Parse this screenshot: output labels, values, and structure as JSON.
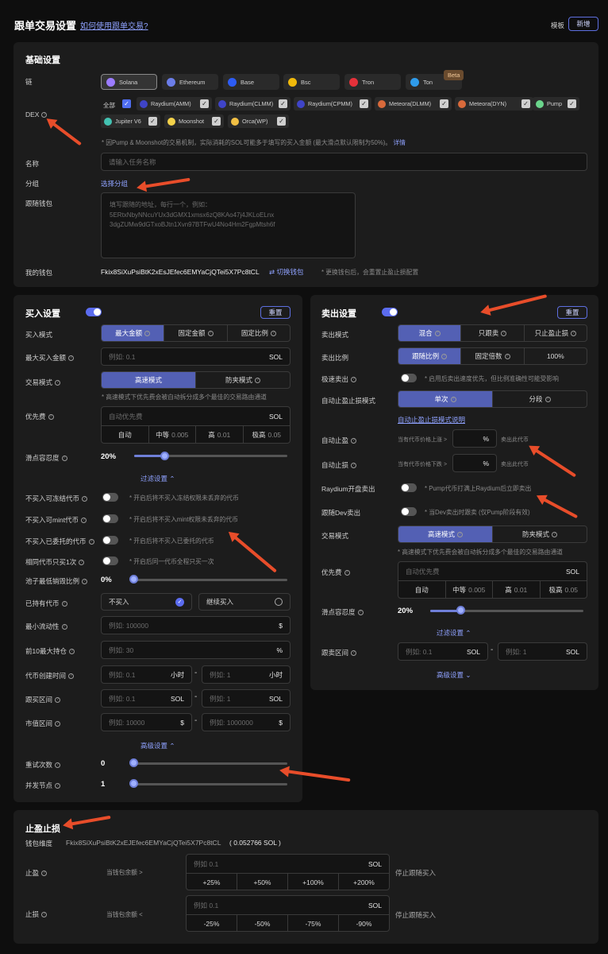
{
  "page": {
    "title": "跟单交易设置",
    "help_link": "如何使用跟单交易?",
    "template_label": "模板",
    "new_button": "新增"
  },
  "basic": {
    "title": "基础设置",
    "chain_label": "链",
    "chains": [
      {
        "name": "Solana",
        "color": "#9b7cff"
      },
      {
        "name": "Ethereum",
        "color": "#6b7de8"
      },
      {
        "name": "Base",
        "color": "#2d5cf5"
      },
      {
        "name": "Bsc",
        "color": "#f0b90b"
      },
      {
        "name": "Tron",
        "color": "#e5313a"
      },
      {
        "name": "Ton",
        "color": "#2f9bea"
      }
    ],
    "beta_badge": "Beta",
    "dex_label": "DEX",
    "dex_all": "全部",
    "dexes": [
      {
        "name": "Raydium(AMM)",
        "color": "#3f44c8"
      },
      {
        "name": "Raydium(CLMM)",
        "color": "#3f44c8"
      },
      {
        "name": "Raydium(CPMM)",
        "color": "#3f44c8"
      },
      {
        "name": "Meteora(DLMM)",
        "color": "#d96a3b"
      },
      {
        "name": "Meteora(DYN)",
        "color": "#d96a3b"
      },
      {
        "name": "Pump",
        "color": "#6bd58c"
      },
      {
        "name": "Jupiter V6",
        "color": "#43c2b2"
      },
      {
        "name": "Moonshot",
        "color": "#f4d24a"
      },
      {
        "name": "Orca(WP)",
        "color": "#f2c044"
      }
    ],
    "dex_note": "* 因Pump & Moonshot的交易机制，实际消耗的SOL可能多于填写的买入金额 (最大滑点默认限制为50%)。",
    "dex_note_link": "详情",
    "name_label": "名称",
    "name_placeholder": "请输入任务名称",
    "group_label": "分组",
    "group_link": "选择分组",
    "follow_wallet_label": "跟随钱包",
    "follow_wallet_placeholder": [
      "填写跟随的地址，每行一个，例如：",
      "5ERtxNbyNNcuYUx3dGMX1xmsx6zQ8KAo47j4JKLoELnx",
      "3dgZUMw9dGTxoBJtn1Xvn97BTFwU4No4Hm2FgpMtsh6f"
    ],
    "my_wallet_label": "我的钱包",
    "my_wallet_value": "Fkix8SiXuPsiBtK2xEsJEfec6EMYaCjQTei5X7Pc8tCL",
    "switch_wallet": "切换钱包",
    "switch_note": "* 更换钱包后，会重置止盈止损配置"
  },
  "buy": {
    "title": "买入设置",
    "reset": "重置",
    "mode_label": "买入模式",
    "modes": [
      "最大金额",
      "固定金额",
      "固定比例"
    ],
    "max_amount_label": "最大买入金额",
    "max_amount_placeholder": "例如: 0.1",
    "unit_sol": "SOL",
    "trade_mode_label": "交易模式",
    "trade_modes": [
      "高速模式",
      "防夹模式"
    ],
    "trade_note": "* 高速模式下优先费会被自动拆分成多个最佳的交易路由通道",
    "priority_label": "优先费",
    "priority_placeholder": "自动优先费",
    "priority_opts": [
      {
        "name": "自动",
        "val": ""
      },
      {
        "name": "中等",
        "val": "0.005"
      },
      {
        "name": "高",
        "val": "0.01"
      },
      {
        "name": "极高",
        "val": "0.05"
      }
    ],
    "slippage_label": "滑点容忍度",
    "slippage_value": "20%",
    "slippage_fraction": 0.2,
    "filter_link": "过滤设置 ⌃",
    "toggles": [
      {
        "label": "不买入可冻结代币",
        "note": "* 开启后将不买入冻结权限未丢弃的代币"
      },
      {
        "label": "不买入可mint代币",
        "note": "* 开启后将不买入mint权限未丢弃的代币"
      },
      {
        "label": "不买入已委托的代币",
        "note": "* 开启后将不买入已委托的代币"
      },
      {
        "label": "相同代币只买1次",
        "note": "* 开启后同一代币全程只买一次"
      }
    ],
    "burn_label": "池子最低销毁比例",
    "burn_value": "0%",
    "hold_label": "已持有代币",
    "hold_opts": [
      "不买入",
      "继续买入"
    ],
    "liquidity_label": "最小流动性",
    "liquidity_placeholder": "例如: 100000",
    "unit_usd": "$",
    "top10_label": "前10最大持仓",
    "top10_placeholder": "例如: 30",
    "unit_pct": "%",
    "created_label": "代币创建时间",
    "created_from": "例如: 0.1",
    "created_to": "例如: 1",
    "unit_hour": "小时",
    "follow_range_label": "跟买区间",
    "follow_from": "例如: 0.1",
    "follow_to": "例如: 1",
    "mcap_label": "市值区间",
    "mcap_from": "例如: 10000",
    "mcap_to": "例如: 1000000",
    "advanced_link": "高级设置 ⌃",
    "retry_label": "重试次数",
    "retry_value": "0",
    "concurrency_label": "并发节点",
    "concurrency_value": "1",
    "dash": "-"
  },
  "sell": {
    "title": "卖出设置",
    "reset": "重置",
    "mode_label": "卖出模式",
    "modes": [
      "混合",
      "只跟卖",
      "只止盈止损"
    ],
    "ratio_label": "卖出比例",
    "ratios": [
      "跟随比例",
      "固定倍数",
      "100%"
    ],
    "fast_label": "极速卖出",
    "fast_note": "* 启用后卖出速度优先，但比例准确性可能受影响",
    "auto_mode_label": "自动止盈止损模式",
    "auto_modes": [
      "单次",
      "分段"
    ],
    "auto_mode_link": "自动止盈止损模式说明",
    "tp_label": "自动止盈",
    "tp_prefix": "当有代币价格上涨 >",
    "tp_suffix": "卖出此代币",
    "sl_label": "自动止损",
    "sl_prefix": "当有代币价格下跌 >",
    "sl_suffix": "卖出此代币",
    "unit_pct": "%",
    "raydium_label": "Raydium开盘卖出",
    "raydium_note": "* Pump代币打满上Raydium后立即卖出",
    "dev_label": "跟随Dev卖出",
    "dev_note": "* 当Dev卖出时跟卖 (仅Pump阶段有效)",
    "trade_mode_label": "交易模式",
    "trade_modes": [
      "高速模式",
      "防夹模式"
    ],
    "trade_note": "* 高速模式下优先费会被自动拆分成多个最佳的交易路由通道",
    "priority_label": "优先费",
    "priority_placeholder": "自动优先费",
    "unit_sol": "SOL",
    "priority_opts": [
      {
        "name": "自动",
        "val": ""
      },
      {
        "name": "中等",
        "val": "0.005"
      },
      {
        "name": "高",
        "val": "0.01"
      },
      {
        "name": "极高",
        "val": "0.05"
      }
    ],
    "slippage_label": "滑点容忍度",
    "slippage_value": "20%",
    "slippage_fraction": 0.2,
    "filter_link": "过滤设置 ⌃",
    "range_label": "跟卖区间",
    "range_from": "例如: 0.1",
    "range_to": "例如: 1",
    "dash": "-",
    "advanced_link": "高级设置 ⌄"
  },
  "tpsl": {
    "title": "止盈止损",
    "wallet_label": "钱包维度",
    "wallet_value": "Fkix8SiXuPsiBtK2xEJEfec6EMYaCjQTei5X7Pc8tCL",
    "wallet_balance": "( 0.052766 SOL )",
    "tp_label": "止盈",
    "tp_cond": "当钱包余额 >",
    "tp_placeholder": "例如 0.1",
    "tp_opts": [
      "+25%",
      "+50%",
      "+100%",
      "+200%"
    ],
    "tp_action": "停止跟随买入",
    "sl_label": "止损",
    "sl_cond": "当钱包余额 <",
    "sl_placeholder": "例如 0.1",
    "sl_opts": [
      "-25%",
      "-50%",
      "-75%",
      "-90%"
    ],
    "sl_action": "停止跟随买入",
    "unit_sol": "SOL"
  },
  "colors": {
    "accent": "#5360b4",
    "annotation_arrow": "#e84d2a",
    "bg": "#0e0e0e",
    "card": "#1c1c1c"
  }
}
